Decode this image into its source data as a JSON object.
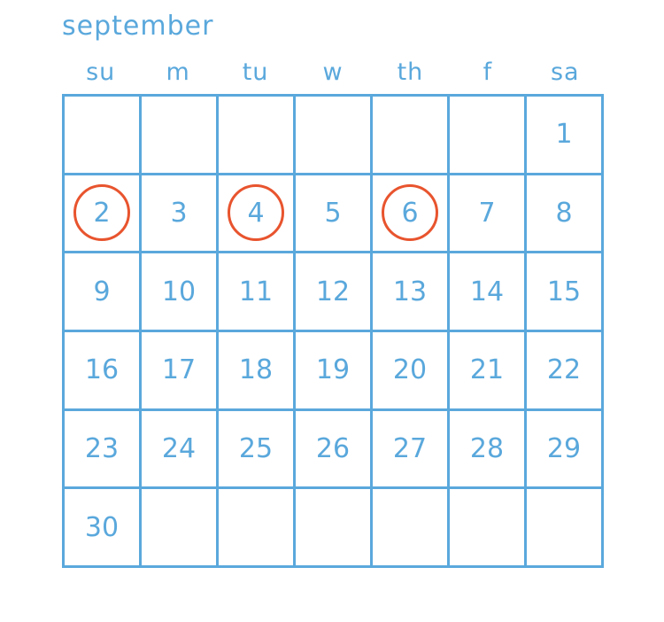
{
  "calendar": {
    "month": "september",
    "weekdays": [
      "su",
      "m",
      "tu",
      "w",
      "th",
      "f",
      "sa"
    ],
    "weeks": [
      [
        "",
        "",
        "",
        "",
        "",
        "",
        "1"
      ],
      [
        "2",
        "3",
        "4",
        "5",
        "6",
        "7",
        "8"
      ],
      [
        "9",
        "10",
        "11",
        "12",
        "13",
        "14",
        "15"
      ],
      [
        "16",
        "17",
        "18",
        "19",
        "20",
        "21",
        "22"
      ],
      [
        "23",
        "24",
        "25",
        "26",
        "27",
        "28",
        "29"
      ],
      [
        "30",
        "",
        "",
        "",
        "",
        "",
        ""
      ]
    ],
    "circled_days": [
      "2",
      "4",
      "6"
    ],
    "colors": {
      "text_and_grid": "#5aa8dc",
      "circle": "#e8542e"
    }
  }
}
